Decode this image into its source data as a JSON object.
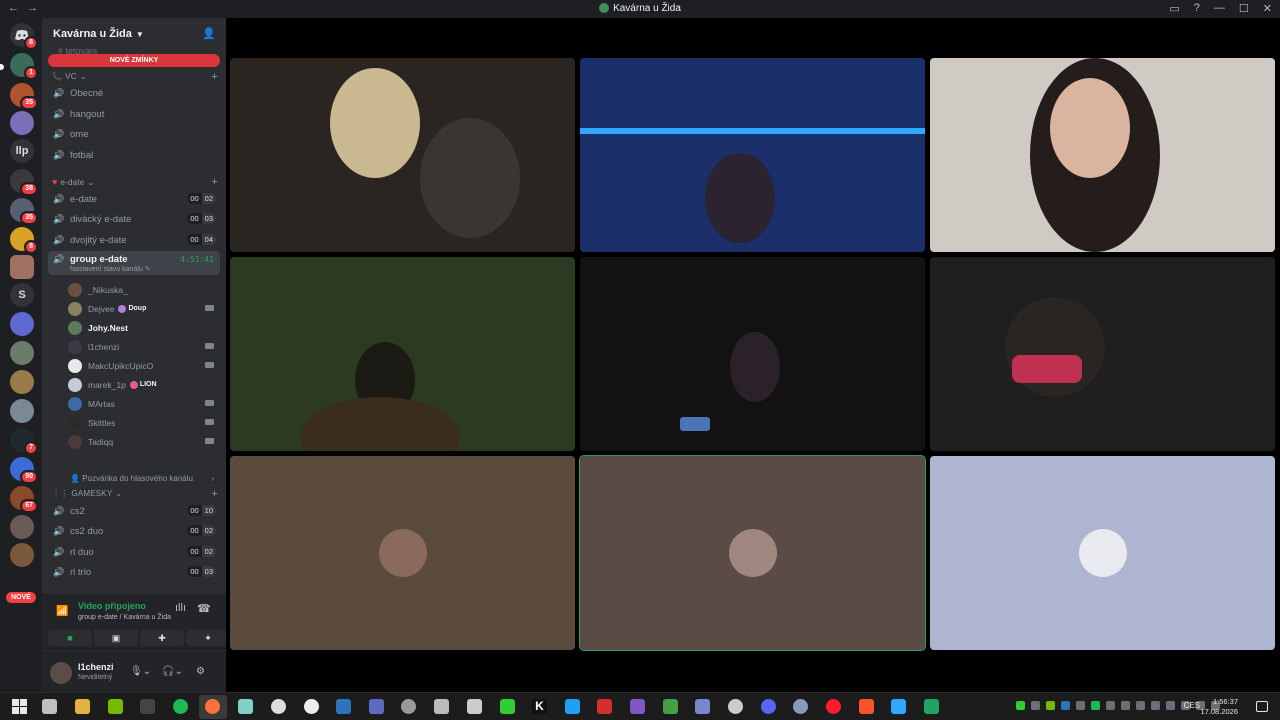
{
  "window": {
    "title": "Kavárna u Žida",
    "nav_back": "←",
    "nav_forward": "→",
    "inbox_icon": "inbox-icon",
    "help_icon": "help-icon",
    "minimize": "—",
    "maximize": "☐",
    "close": "✕"
  },
  "rail": {
    "home_badge": "8",
    "servers": [
      {
        "badge": "1"
      },
      {
        "badge": "35"
      },
      {
        "badge": ""
      },
      {
        "label": "llp"
      },
      {
        "badge": "38"
      },
      {
        "badge": "35"
      },
      {
        "badge": "8"
      },
      {
        "badge": ""
      },
      {
        "label": "S"
      },
      {
        "badge": ""
      },
      {
        "badge": ""
      },
      {
        "badge": ""
      },
      {
        "badge": ""
      },
      {
        "badge": "7"
      },
      {
        "badge": "90"
      },
      {
        "badge": "67"
      },
      {
        "badge": ""
      },
      {
        "badge": ""
      }
    ],
    "new_pill": "NOVÉ"
  },
  "sidebar": {
    "server_name": "Kavárna u Žida",
    "faded_channel": "tetovani",
    "mentions_banner": "NOVÉ ZMÍNKY",
    "categories": {
      "vc": "VC",
      "edate": "e-date",
      "gamesky": "GAMESKY"
    },
    "vc_channels": [
      "Obecné",
      "hangout",
      "ome",
      "fotbal"
    ],
    "edate_channels": [
      {
        "name": "e-date",
        "count_a": "00",
        "count_b": "02"
      },
      {
        "name": "divácký e-date",
        "count_a": "00",
        "count_b": "03"
      },
      {
        "name": "dvojitý e-date",
        "count_a": "00",
        "count_b": "04"
      }
    ],
    "active_channel": {
      "name": "group e-date",
      "timer": "4:51:41",
      "status": "Nastavení stavu kanálu"
    },
    "voice_users": [
      {
        "name": "_Nikuska_",
        "tag": ""
      },
      {
        "name": "Dejvee",
        "tag": "Doup"
      },
      {
        "name": "Johy.Nest",
        "tag": ""
      },
      {
        "name": "l1chenzi",
        "tag": ""
      },
      {
        "name": "MakcUpikcUpicO",
        "tag": ""
      },
      {
        "name": "marek_1p",
        "tag": "LION"
      },
      {
        "name": "MArtas",
        "tag": ""
      },
      {
        "name": "Skittles",
        "tag": ""
      },
      {
        "name": "Tadiqq",
        "tag": ""
      }
    ],
    "invite_row": "Pozvánka do hlasového kanálu",
    "gamesky_channels": [
      {
        "name": "cs2",
        "count_a": "00",
        "count_b": "10"
      },
      {
        "name": "cs2 duo",
        "count_a": "00",
        "count_b": "02"
      },
      {
        "name": "rl duo",
        "count_a": "00",
        "count_b": "02"
      },
      {
        "name": "rl trio",
        "count_a": "00",
        "count_b": "03"
      }
    ]
  },
  "voice_panel": {
    "title": "Video připojeno",
    "subtitle": "group e-date / Kavárna u Žida"
  },
  "user_panel": {
    "username": "l1chenzi",
    "status": "Neviditelný"
  },
  "taskbar": {
    "language": "CES",
    "time": "1:56:37",
    "date": "17.08.2026"
  },
  "colors": {
    "accent_green": "#23a55a",
    "mention_red": "#da373c",
    "sidebar_bg": "#2b2d31",
    "rail_bg": "#1e1f22"
  }
}
